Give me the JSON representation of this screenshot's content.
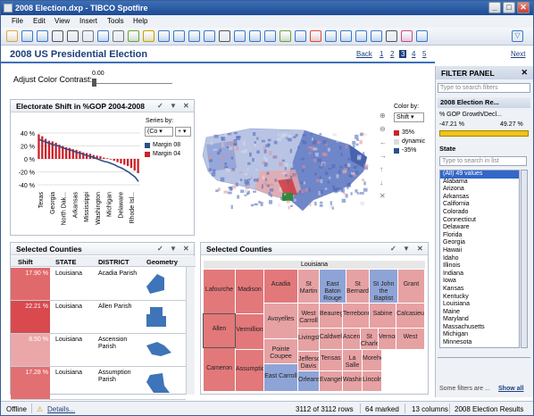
{
  "window": {
    "title": "2008 Election.dxp - TIBCO Spotfire"
  },
  "menu": [
    "File",
    "Edit",
    "View",
    "Insert",
    "Tools",
    "Help"
  ],
  "page": {
    "title": "2008 US Presidential Election"
  },
  "pager": {
    "back": "Back",
    "pages": [
      "1",
      "2",
      "3",
      "4",
      "5"
    ],
    "current": "3",
    "next": "Next"
  },
  "contrast": {
    "label": "Adjust Color Contrast:",
    "value": "0.00"
  },
  "bar_panel": {
    "title": "Electorate Shift in %GOP 2004-2008",
    "series_label": "Series by:",
    "series_value": "(Co",
    "series_plus": "+",
    "legend": [
      {
        "name": "Margin 08",
        "color": "#2c4f8c"
      },
      {
        "name": "Margin 04",
        "color": "#cc2229"
      }
    ]
  },
  "chart_data": {
    "type": "bar",
    "ylim": [
      -40,
      40
    ],
    "yticks": [
      "40 %",
      "20 %",
      "0 %",
      "-20 %",
      "-40 %"
    ],
    "categories": [
      "Texas",
      "Georgia",
      "North Dak...",
      "Arkansas",
      "Mississippi",
      "Washington",
      "Michigan",
      "Delaware",
      "Rhode Isl..."
    ],
    "series": [
      {
        "name": "Margin 04",
        "values": [
          38,
          35,
          31,
          28,
          27,
          25,
          22,
          20,
          18,
          17,
          15,
          14,
          12,
          10,
          9,
          8,
          6,
          5,
          4,
          2,
          1,
          -1,
          -3,
          -5,
          -7,
          -9,
          -11,
          -14,
          -18,
          -22
        ]
      },
      {
        "name": "Margin 08",
        "values": [
          30,
          28,
          26,
          24,
          22,
          21,
          19,
          17,
          15,
          14,
          12,
          10,
          9,
          7,
          5,
          4,
          2,
          0,
          -2,
          -4,
          -5,
          -7,
          -9,
          -12,
          -14,
          -17,
          -20,
          -24,
          -28,
          -35
        ]
      }
    ]
  },
  "map_panel": {
    "color_by_label": "Color by:",
    "color_by_value": "Shift",
    "legend": [
      {
        "label": "35%",
        "color": "#cc2229"
      },
      {
        "label": "dynamic",
        "color": "#dcdcdc"
      },
      {
        "label": "-35%",
        "color": "#2c4f8c"
      }
    ]
  },
  "table_panel": {
    "title": "Selected Counties",
    "columns": [
      "Shift",
      "STATE",
      "DISTRICT",
      "Geometry"
    ],
    "rows": [
      {
        "shift": "17.90 %",
        "state": "Louisiana",
        "district": "Acadia Parish",
        "color": "#e0696c"
      },
      {
        "shift": "22.21 %",
        "state": "Louisiana",
        "district": "Allen Parish",
        "color": "#d84a4e"
      },
      {
        "shift": "8.50 %",
        "state": "Louisiana",
        "district": "Ascension Parish",
        "color": "#eba7a8"
      },
      {
        "shift": "17.28 %",
        "state": "Louisiana",
        "district": "Assumption Parish",
        "color": "#e26f72"
      }
    ]
  },
  "treemap_panel": {
    "title": "Selected Counties",
    "header": "Louisiana",
    "cells": [
      {
        "label": "Lafourche",
        "color": "#e2787a"
      },
      {
        "label": "Madison",
        "color": "#e2787a"
      },
      {
        "label": "Acadia",
        "color": "#e2787a"
      },
      {
        "label": "St Martin",
        "color": "#e6a1a3"
      },
      {
        "label": "East Baton Rouge",
        "color": "#8fa4d6"
      },
      {
        "label": "St Bernard",
        "color": "#e6a1a3"
      },
      {
        "label": "St John the Baptist",
        "color": "#8fa4d6"
      },
      {
        "label": "Grant",
        "color": "#e6a1a3"
      },
      {
        "label": "Allen",
        "color": "#e2787a"
      },
      {
        "label": "Vermillion",
        "color": "#e2787a"
      },
      {
        "label": "Avoyelles",
        "color": "#e6a1a3"
      },
      {
        "label": "West Carroll",
        "color": "#e6a1a3"
      },
      {
        "label": "Beauregard",
        "color": "#e6a1a3"
      },
      {
        "label": "Terrebonne",
        "color": "#e6a1a3"
      },
      {
        "label": "Sabine",
        "color": "#e6a1a3"
      },
      {
        "label": "Calcasieu",
        "color": "#e6a1a3"
      },
      {
        "label": "Livingston",
        "color": "#e6a1a3"
      },
      {
        "label": "Caldwell",
        "color": "#e6a1a3"
      },
      {
        "label": "Ascension",
        "color": "#e6a1a3"
      },
      {
        "label": "St Charles",
        "color": "#e6a1a3"
      },
      {
        "label": "Vernon",
        "color": "#e6a1a3"
      },
      {
        "label": "West",
        "color": "#e6a1a3"
      },
      {
        "label": "Pointe Coupee",
        "color": "#e6a1a3"
      },
      {
        "label": "Jefferson Davis",
        "color": "#e6a1a3"
      },
      {
        "label": "Tensas",
        "color": "#e6a1a3"
      },
      {
        "label": "La Salle",
        "color": "#e6a1a3"
      },
      {
        "label": "Morehouse",
        "color": "#e6a1a3"
      },
      {
        "label": "Cameron",
        "color": "#e2787a"
      },
      {
        "label": "Assumption",
        "color": "#e2787a"
      },
      {
        "label": "East Carroll",
        "color": "#8fa4d6"
      },
      {
        "label": "Orleans",
        "color": "#8fa4d6"
      },
      {
        "label": "Evangeline",
        "color": "#e6a1a3"
      },
      {
        "label": "Washington",
        "color": "#e6a1a3"
      },
      {
        "label": "Lincoln",
        "color": "#e6a1a3"
      }
    ]
  },
  "filter_panel": {
    "title": "FILTER PANEL",
    "search_placeholder": "Type to search filters",
    "group": "2008 Election Re...",
    "gop_label": "% GOP Growth/Decl...",
    "gop_min": "-47.21 %",
    "gop_max": "49.27 %",
    "state_label": "State",
    "state_search": "Type to search in list",
    "states": [
      "(All) 49 values",
      "Alabama",
      "Arizona",
      "Arkansas",
      "California",
      "Colorado",
      "Connecticut",
      "Delaware",
      "Florida",
      "Georgia",
      "Hawaii",
      "Idaho",
      "Illinois",
      "Indiana",
      "Iowa",
      "Kansas",
      "Kentucky",
      "Louisiana",
      "Maine",
      "Maryland",
      "Massachusetts",
      "Michigan",
      "Minnesota"
    ],
    "footer": "Some filters are ...",
    "show_all": "Show all"
  },
  "status": {
    "offline": "Offline",
    "details": "Details...",
    "rows": "3112 of 3112 rows",
    "marked": "64 marked",
    "columns": "13 columns",
    "table": "2008 Election Results"
  }
}
